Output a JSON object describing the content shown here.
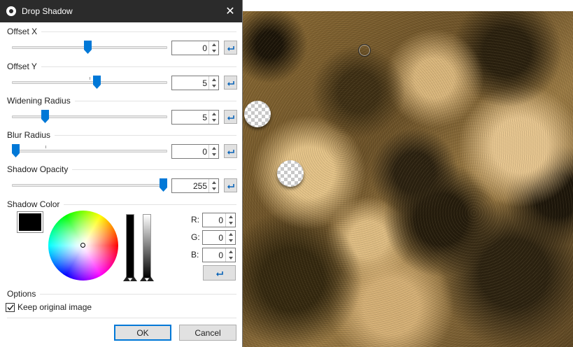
{
  "dialog": {
    "title": "Drop Shadow",
    "close_glyph": "✕"
  },
  "params": [
    {
      "label": "Offset X",
      "value": "0",
      "fraction": 0.49
    },
    {
      "label": "Offset Y",
      "value": "5",
      "fraction": 0.55
    },
    {
      "label": "Widening Radius",
      "value": "5",
      "fraction": 0.2
    },
    {
      "label": "Blur Radius",
      "value": "0",
      "fraction": 0.0
    },
    {
      "label": "Shadow Opacity",
      "value": "255",
      "fraction": 1.0
    }
  ],
  "shadow_color": {
    "label": "Shadow Color",
    "swatch_color": "#000000",
    "r_label": "R:",
    "g_label": "G:",
    "b_label": "B:",
    "r": "0",
    "g": "0",
    "b": "0"
  },
  "options": {
    "label": "Options",
    "keep_original_label": "Keep original image",
    "keep_original_checked": true
  },
  "buttons": {
    "ok": "OK",
    "cancel": "Cancel"
  },
  "colors": {
    "accent": "#0078d7",
    "titlebar": "#2b2b2b"
  },
  "icons": {
    "reset": "undo-arrow-icon",
    "app": "ring-icon",
    "close": "close-icon"
  }
}
